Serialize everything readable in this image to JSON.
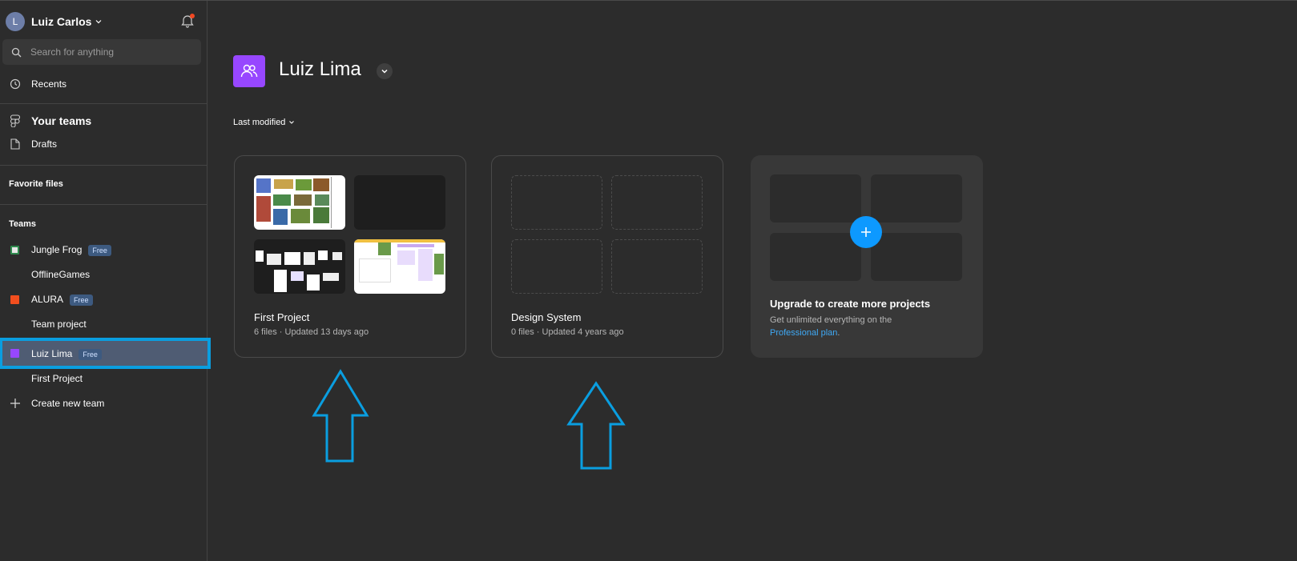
{
  "user": {
    "initial": "L",
    "name": "Luiz Carlos"
  },
  "search": {
    "placeholder": "Search for anything"
  },
  "nav": {
    "recents": "Recents",
    "your_teams": "Your teams",
    "drafts": "Drafts"
  },
  "sections": {
    "favorite_files": "Favorite files",
    "teams": "Teams"
  },
  "teams": [
    {
      "name": "Jungle Frog",
      "badge": "Free",
      "color": "#2f8a4e"
    },
    {
      "name": "OfflineGames"
    },
    {
      "name": "ALURA",
      "badge": "Free",
      "color": "#f24e1e"
    },
    {
      "name": "Team project"
    },
    {
      "name": "Luiz Lima",
      "badge": "Free",
      "color": "#9747ff",
      "selected": true
    },
    {
      "name": "First Project"
    }
  ],
  "create_team": "Create new team",
  "header": {
    "team_name": "Luiz Lima"
  },
  "sort": {
    "label": "Last modified"
  },
  "projects": [
    {
      "name": "First Project",
      "meta": "6 files · Updated 13 days ago"
    },
    {
      "name": "Design System",
      "meta": "0 files · Updated 4 years ago"
    }
  ],
  "upgrade": {
    "title": "Upgrade to create more projects",
    "desc": "Get unlimited everything on the",
    "link": "Professional plan",
    "period": "."
  },
  "colors": {
    "accent": "#0d99ff",
    "team_purple": "#9747ff",
    "highlight": "#0a9ee0"
  }
}
